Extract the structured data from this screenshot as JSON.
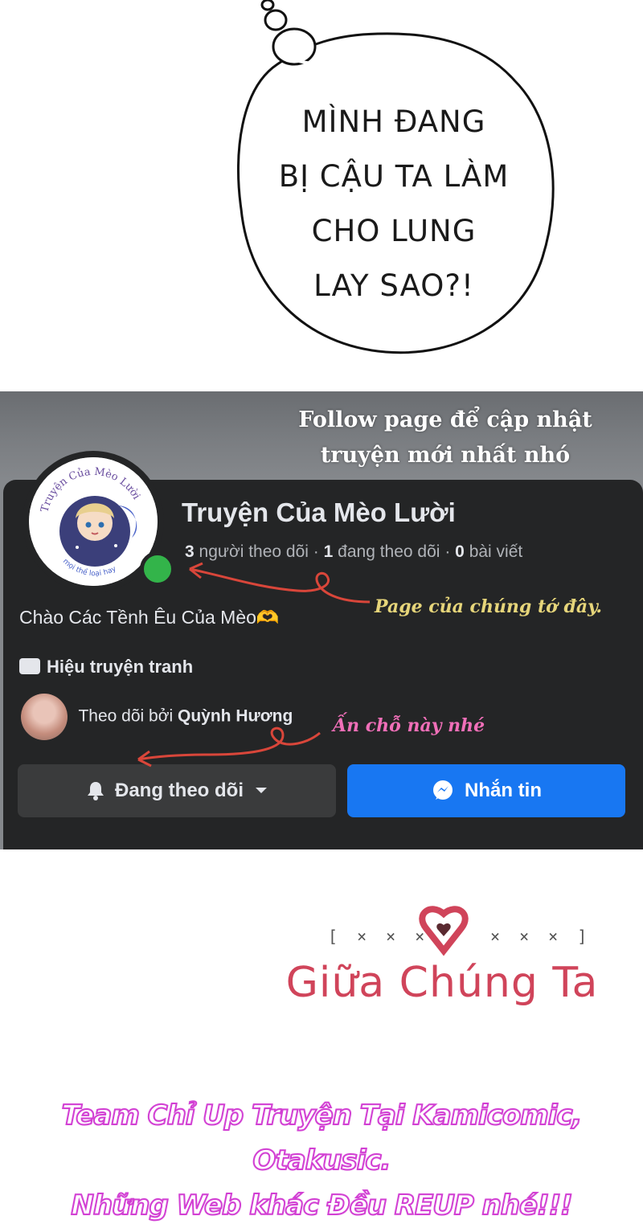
{
  "bubble": {
    "lines": [
      "MÌNH ĐANG",
      "BỊ CẬU TA LÀM",
      "CHO LUNG",
      "LAY SAO?!"
    ]
  },
  "promo": {
    "line1": "Follow page để cập nhật",
    "line2": "truyện mới nhất nhó"
  },
  "fb_page": {
    "avatar_text": "Truyện Của Mèo Lười",
    "avatar_subtext": "mọi thể loại hay",
    "name": "Truyện Của Mèo Lười",
    "stats": {
      "followers_count": "3",
      "followers_label": "người theo dõi",
      "following_count": "1",
      "following_label": "đang theo dõi",
      "posts_count": "0",
      "posts_label": "bài viết",
      "separator": "·"
    },
    "greeting": "Chào Các Tềnh Êu Của Mèo🫶",
    "category": "Hiệu truyện tranh",
    "followed_by_prefix": "Theo dõi bởi",
    "followed_by_name": "Quỳnh Hương",
    "follow_button": "Đang theo dõi",
    "message_button": "Nhắn tin",
    "colors": {
      "card_bg": "#242526",
      "primary_button": "#1877f2",
      "secondary_button": "#3a3b3c",
      "online": "#33b44a"
    }
  },
  "annotations": {
    "page_note": "Page của chúng tớ đây.",
    "click_note": "Ấn chỗ này nhé",
    "arrow_color": "#d9463a"
  },
  "logo": {
    "bracket_left": "[ × × ×",
    "bracket_right": "× × × ]",
    "title": "Giữa Chúng Ta",
    "accent": "#d0445a"
  },
  "footer": {
    "line1": "Team Chỉ Up Truyện Tại Kamicomic, Otakusic.",
    "line2": "Những Web khác Đều REUP nhé!!!"
  }
}
